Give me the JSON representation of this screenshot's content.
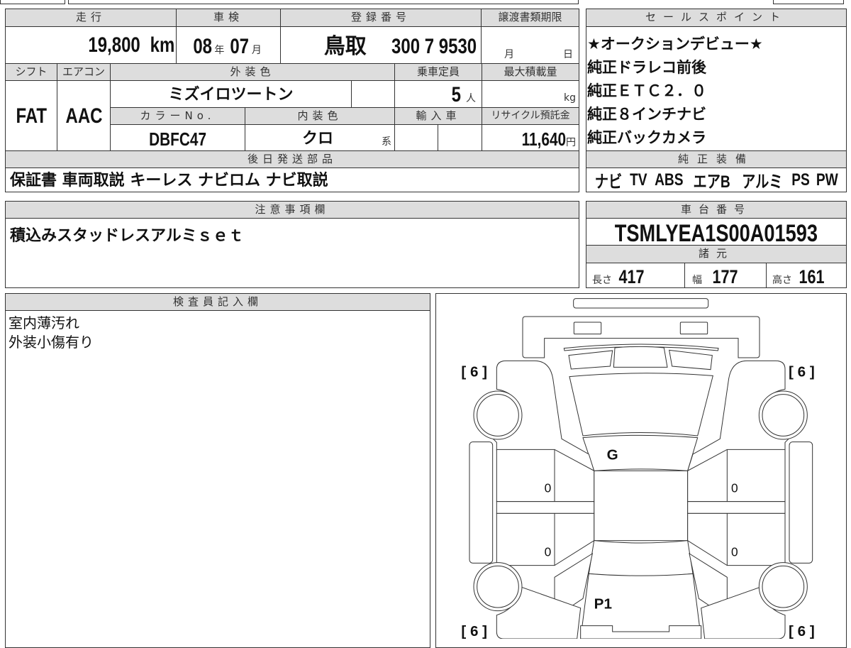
{
  "headers": {
    "mileage": "走行",
    "inspection": "車検",
    "registration": "登録番号",
    "transfer_deadline": "譲渡書類期限",
    "shift": "シフト",
    "aircon": "エアコン",
    "exterior_color": "外装色",
    "capacity": "乗車定員",
    "max_load": "最大積載量",
    "color_no": "カラーNo.",
    "interior_color": "内装色",
    "import": "輸入車",
    "recycle": "リサイクル預託金",
    "later_parts": "後日発送部品",
    "sales_points": "セールスポイント",
    "equipment": "純正装備",
    "notes": "注意事項欄",
    "chassis": "車台番号",
    "specs": "諸元",
    "inspector": "検査員記入欄"
  },
  "values": {
    "mileage": "19,800",
    "mileage_unit": "km",
    "insp_year": "08",
    "year_unit": "年",
    "insp_month": "07",
    "month_unit": "月",
    "plate_region": "鳥取",
    "plate_number": "300 7 9530",
    "deadline_month": "月",
    "deadline_day": "日",
    "shift": "FAT",
    "aircon": "AAC",
    "exterior_color": "ミズイロツートン",
    "capacity": "5",
    "capacity_unit": "人",
    "load_unit": "kg",
    "color_no": "DBFC47",
    "interior_color": "クロ",
    "interior_suffix": "系",
    "recycle": "11,640",
    "recycle_unit": "円"
  },
  "later_parts": "保証書 車両取説 キーレス ナビロム ナビ取説",
  "sales_points": [
    "★オークションデビュー★",
    "純正ドラレコ前後",
    "純正ＥＴＣ２．０",
    "純正８インチナビ",
    "純正バックカメラ"
  ],
  "equipment": [
    "ナビ",
    "TV",
    "ABS",
    "エアB",
    "アルミ",
    "PS",
    "PW"
  ],
  "notes": "積込みスタッドレスアルミｓｅｔ",
  "chassis_number": "TSMLYEA1S00A01593",
  "specs": {
    "length_label": "長さ",
    "length": "417",
    "width_label": "幅",
    "width": "177",
    "height_label": "高さ",
    "height": "161"
  },
  "inspector_notes": [
    "室内薄汚れ",
    "外装小傷有り"
  ],
  "diagram": {
    "tread_fl": "[ 6 ]",
    "tread_fr": "[ 6 ]",
    "tread_rl": "[ 6 ]",
    "tread_rr": "[ 6 ]",
    "roof": "G",
    "hood": "P1",
    "door_lr": "0",
    "door_lf": "0",
    "door_rr": "0",
    "door_rf": "0"
  }
}
